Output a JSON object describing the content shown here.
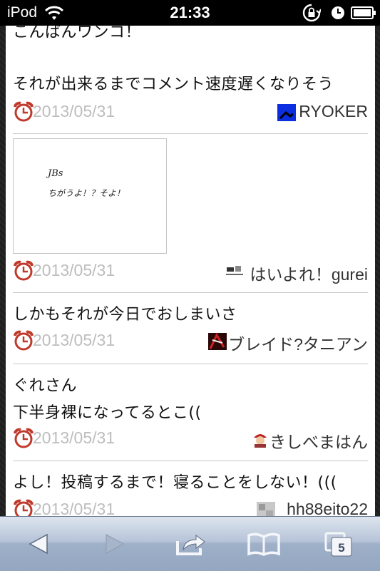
{
  "status_bar": {
    "carrier": "iPod",
    "time": "21:33"
  },
  "posts": [
    {
      "lines": [
        "こんばんワンコ！",
        "",
        "それが出来るまでコメント速度遅くなりそう"
      ],
      "date": "2013/05/31",
      "author": "RYOKER"
    },
    {
      "image_text": [
        "JBs",
        "ちがうよ！？そよ！"
      ],
      "date": "2013/05/31",
      "author": "はいよれ！gurei"
    },
    {
      "lines": [
        "しかもそれが今日でおしまいさ"
      ],
      "date": "2013/05/31",
      "author": "ブレイド?タニアン"
    },
    {
      "lines": [
        "ぐれさん",
        "下半身裸になってるとこ(("
      ],
      "date": "2013/05/31",
      "author": "きしべまはん"
    },
    {
      "lines": [
        "よし！投稿するまで！寝ることをしない！((("
      ],
      "date": "2013/05/31",
      "author": "hh88eito22"
    }
  ],
  "toolbar": {
    "tab_count": "5"
  }
}
